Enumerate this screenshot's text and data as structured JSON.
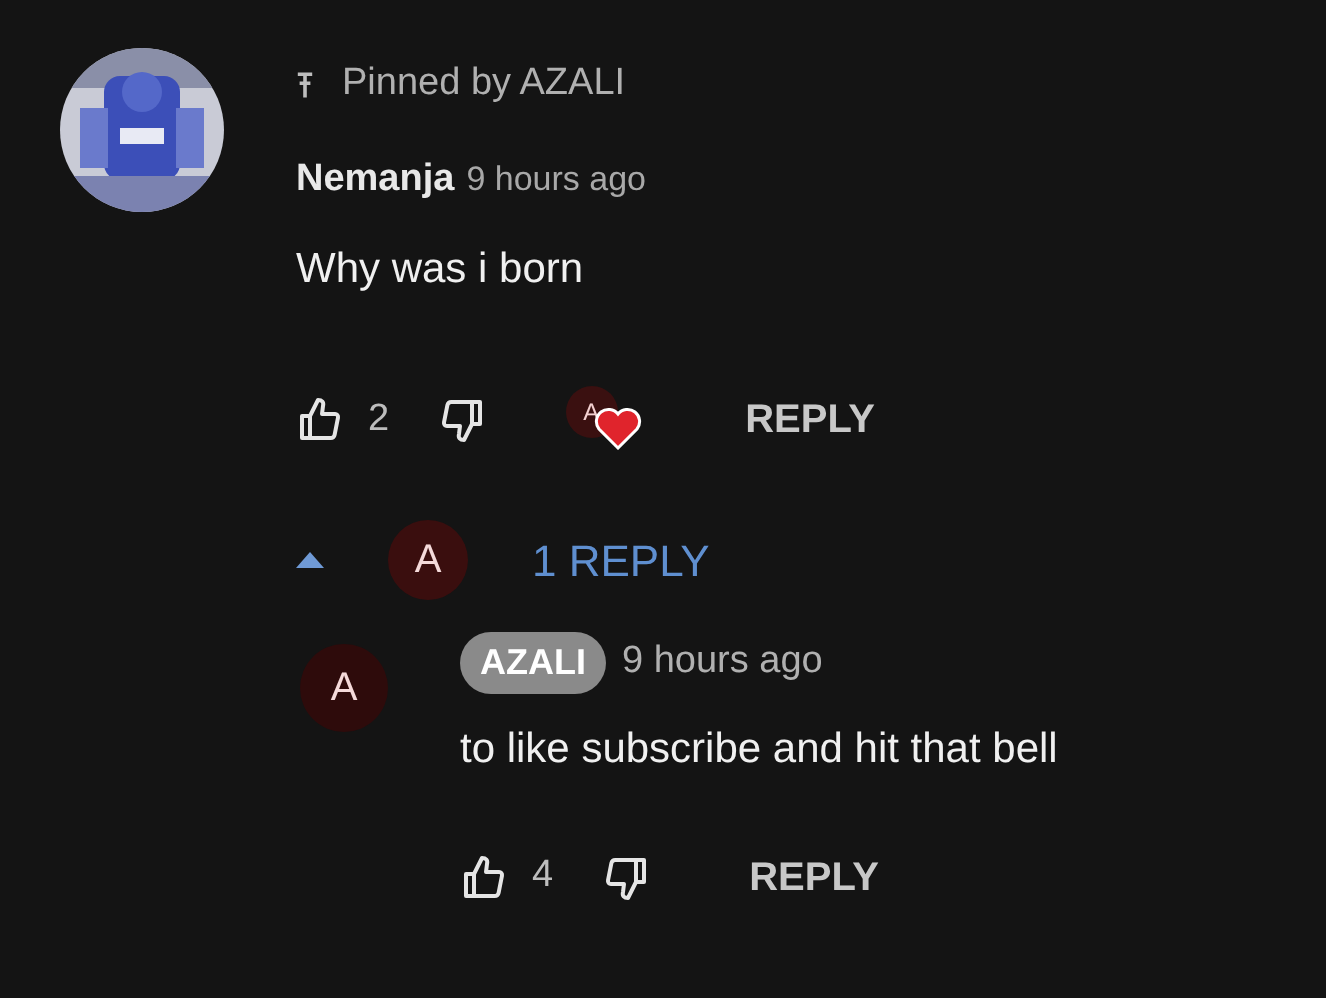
{
  "comment": {
    "pinned_label": "Pinned by AZALI",
    "author": "Nemanja",
    "time": "9 hours ago",
    "text": "Why was i born",
    "likes": "2",
    "creator_heart": true,
    "creator_letter": "A",
    "reply_button": "REPLY"
  },
  "replies_toggle": {
    "expanded": true,
    "avatar_letter": "A",
    "label": "1 REPLY"
  },
  "replies": [
    {
      "avatar_letter": "A",
      "author": "AZALI",
      "is_creator": true,
      "time": "9 hours ago",
      "text": "to like subscribe and hit that bell",
      "likes": "4",
      "reply_button": "REPLY"
    }
  ]
}
